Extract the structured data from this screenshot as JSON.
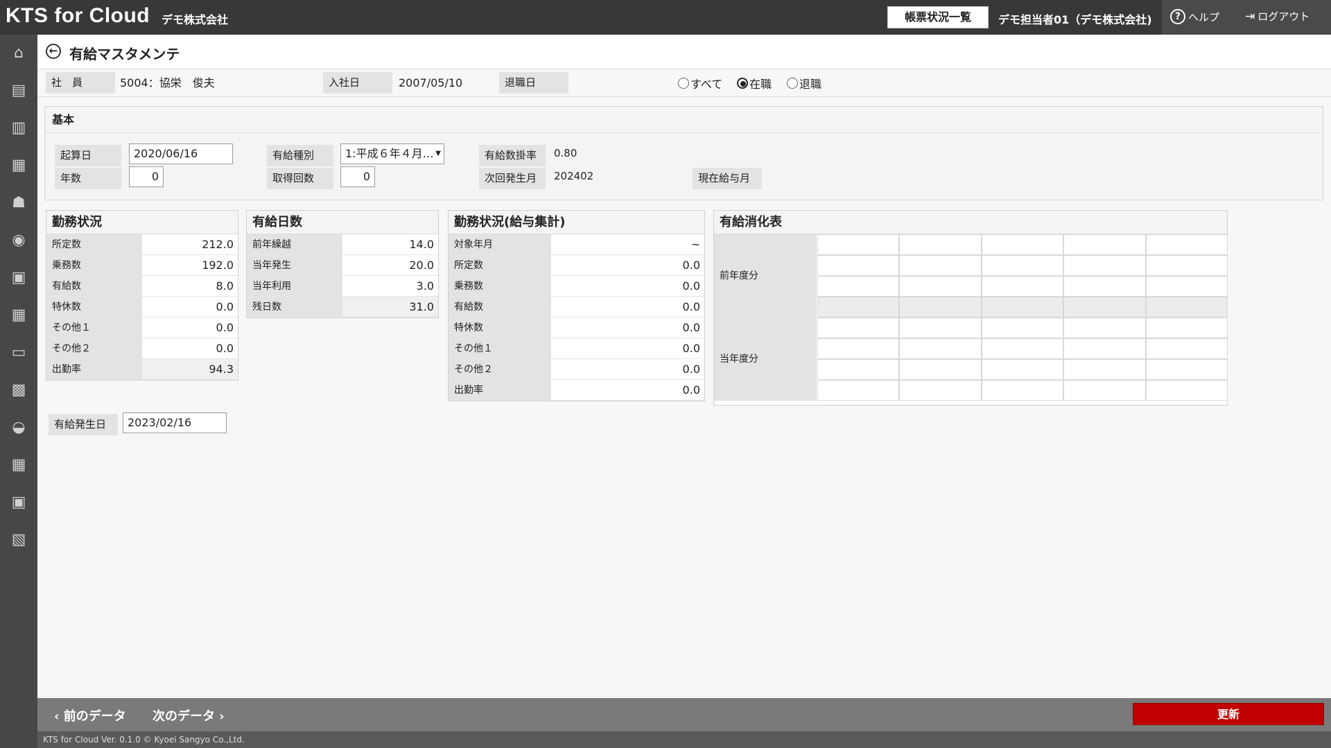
{
  "app": {
    "title": "KTS for Cloud",
    "company": "デモ株式会社",
    "report_button": "帳票状況一覧",
    "user": "デモ担当者01（デモ株式会社)",
    "help": "ヘルプ",
    "logout": "ログアウト"
  },
  "sidebar": {
    "icons": [
      "home-icon",
      "bus-icon",
      "clipboard-icon",
      "building-icon",
      "worker-icon",
      "money-icon",
      "truck-icon",
      "calendar-icon",
      "idcard-icon",
      "vehicle-icon",
      "car-icon",
      "chart-icon",
      "profile-icon",
      "settings-icon"
    ]
  },
  "page": {
    "title": "有給マスタメンテ"
  },
  "employee": {
    "label": "社　員",
    "value": "5004：協栄　俊夫",
    "join_label": "入社日",
    "join_date": "2007/05/10",
    "retire_label": "退職日",
    "retire_date": ""
  },
  "filter": {
    "options": [
      "すべて",
      "在職",
      "退職"
    ],
    "selected": "在職"
  },
  "kihon": {
    "title": "基本",
    "kisan_label": "起算日",
    "kisan_value": "2020/06/16",
    "nensu_label": "年数",
    "nensu_value": "0",
    "shubetsu_label": "有給種別",
    "shubetsu_value": "1:平成６年４月…",
    "kaisu_label": "取得回数",
    "kaisu_value": "0",
    "kakeritsu_label": "有給数掛率",
    "kakeritsu_value": "0.80",
    "jikai_label": "次回発生月",
    "jikai_value": "202402",
    "genzai_label": "現在給与月"
  },
  "kinmu": {
    "title": "勤務状況",
    "rows": [
      {
        "label": "所定数",
        "value": "212.0"
      },
      {
        "label": "乗務数",
        "value": "192.0"
      },
      {
        "label": "有給数",
        "value": "8.0"
      },
      {
        "label": "特休数",
        "value": "0.0"
      },
      {
        "label": "その他１",
        "value": "0.0"
      },
      {
        "label": "その他２",
        "value": "0.0"
      },
      {
        "label": "出勤率",
        "value": "94.3"
      }
    ]
  },
  "yukyu": {
    "title": "有給日数",
    "rows": [
      {
        "label": "前年繰越",
        "value": "14.0"
      },
      {
        "label": "当年発生",
        "value": "20.0"
      },
      {
        "label": "当年利用",
        "value": "3.0"
      },
      {
        "label": "残日数",
        "value": "31.0"
      }
    ]
  },
  "kyuyo": {
    "title": "勤務状況(給与集計)",
    "rows": [
      {
        "label": "対象年月",
        "value": "~"
      },
      {
        "label": "所定数",
        "value": "0.0"
      },
      {
        "label": "乗務数",
        "value": "0.0"
      },
      {
        "label": "有給数",
        "value": "0.0"
      },
      {
        "label": "特休数",
        "value": "0.0"
      },
      {
        "label": "その他１",
        "value": "0.0"
      },
      {
        "label": "その他２",
        "value": "0.0"
      },
      {
        "label": "出勤率",
        "value": "0.0"
      }
    ]
  },
  "shoka": {
    "title": "有給消化表",
    "prev_label": "前年度分",
    "curr_label": "当年度分"
  },
  "hassei": {
    "label": "有給発生日",
    "value": "2023/02/16"
  },
  "footer": {
    "prev": "前のデータ",
    "next": "次のデータ",
    "update": "更新",
    "copyright": "KTS for Cloud Ver. 0.1.0 © Kyoei Sangyo Co.,Ltd."
  }
}
